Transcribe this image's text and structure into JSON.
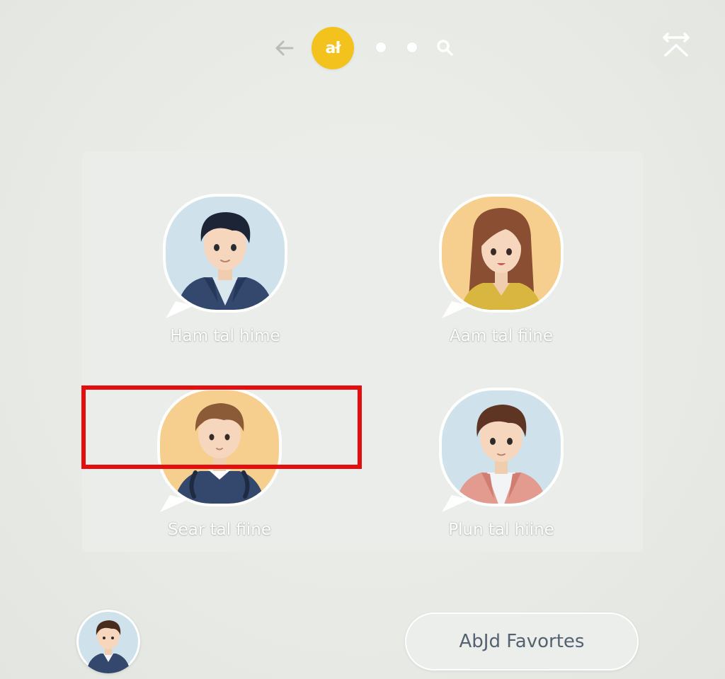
{
  "toolbar": {
    "back_icon": "arrow-left-icon",
    "app_badge_label": "ał",
    "app_badge_color": "#f3c21c",
    "pager_dots": 2,
    "search_icon": "search-icon",
    "corner_icon": "collapse-arrows-icon"
  },
  "contacts": [
    {
      "name": "Ham tal hime",
      "avatar": "man-dark-hair-navy-jacket",
      "bubble_color": "#cfe2ec"
    },
    {
      "name": "Aam tal fiine",
      "avatar": "woman-long-brown-hair-yellow-top",
      "bubble_color": "#f6cf8f"
    },
    {
      "name": "Sear tal fiine",
      "avatar": "boy-brown-hair-headphones",
      "bubble_color": "#f6cf8f"
    },
    {
      "name": "Plun tal hiine",
      "avatar": "man-brown-hair-pink-jacket",
      "bubble_color": "#cfe2ec"
    }
  ],
  "highlight_color": "#e50d0d",
  "footer": {
    "self_avatar": "user-avatar",
    "favorites_button_label": "AbJd Favortes"
  }
}
